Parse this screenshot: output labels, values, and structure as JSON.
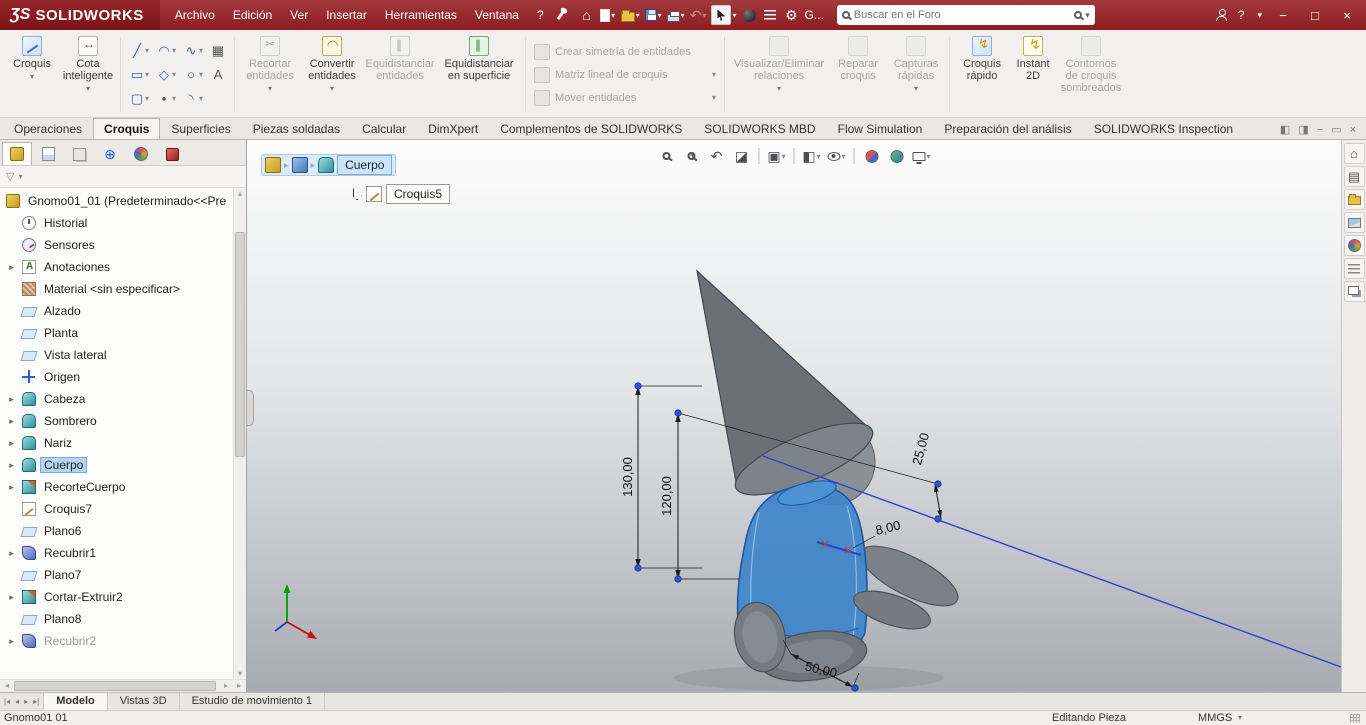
{
  "colors": {
    "titlebar": "#9b2a2e",
    "selection": "#b5d6f2",
    "body_blue": "#3e85c9"
  },
  "icons": {
    "dd": "▾",
    "exp": "▸",
    "home": "⌂",
    "gear": "⚙",
    "undo": "↶",
    "help": "?",
    "min": "−",
    "max": "□",
    "close": "×",
    "left": "◂",
    "right": "▸",
    "up": "▴",
    "down": "▾",
    "funnel": "▽",
    "section": "◪",
    "cube": "▣",
    "halfcube": "◧",
    "prev": "↶",
    "stack": "▤",
    "target": "⊕",
    "paneL": "◧",
    "paneR": "◨",
    "restore": "▭"
  },
  "tools": {
    "line": "╱",
    "arc": "◠",
    "spline": "∿",
    "pattern": "▦",
    "rect": "▭",
    "polygon": "◇",
    "circle": "○",
    "text": "A",
    "slot": "▢",
    "point": "•",
    "arc2": "◝"
  },
  "titlebar": {
    "logo_ds": "ƷS",
    "logo_text": "SOLIDWORKS",
    "menus": [
      "Archivo",
      "Edición",
      "Ver",
      "Insertar",
      "Herramientas",
      "Ventana",
      "?"
    ],
    "g_menu": "G...",
    "search_placeholder": "Buscar en el Foro"
  },
  "ribbon": {
    "r_croquis": "Croquis",
    "r_cota1": "Cota",
    "r_cota2": "inteligente",
    "r_rec1": "Recortar",
    "r_rec2": "entidades",
    "r_con1": "Convertir",
    "r_con2": "entidades",
    "r_eq1": "Equidistanciar",
    "r_eq2": "entidades",
    "r_es1": "Equidistanciar",
    "r_es2": "en superficie",
    "r_sim": "Crear simetría de entidades",
    "r_mat": "Matriz lineal de croquis",
    "r_mov": "Mover entidades",
    "r_vis1": "Visualizar/Eliminar",
    "r_vis2": "relaciones",
    "r_rep1": "Reparar",
    "r_rep2": "croquis",
    "r_cap1": "Capturas",
    "r_cap2": "rápidas",
    "r_cr1": "Croquis",
    "r_cr2": "rápido",
    "r_in1": "Instant",
    "r_in2": "2D",
    "r_co1": "Contornos",
    "r_co2": "de croquis",
    "r_co3": "sombreados"
  },
  "tabs": [
    "Operaciones",
    "Croquis",
    "Superficies",
    "Piezas soldadas",
    "Calcular",
    "DimXpert",
    "Complementos de SOLIDWORKS",
    "SOLIDWORKS MBD",
    "Flow Simulation",
    "Preparación del análisis",
    "SOLIDWORKS Inspection"
  ],
  "tree": {
    "items": [
      "Gnomo01_01 (Predeterminado<<Pre",
      "Historial",
      "Sensores",
      "Anotaciones",
      "Material <sin especificar>",
      "Alzado",
      "Planta",
      "Vista lateral",
      "Origen",
      "Cabeza",
      "Sombrero",
      "Nariz",
      "Cuerpo",
      "RecorteCuerpo",
      "Croquis7",
      "Plano6",
      "Recubrir1",
      "Plano7",
      "Cortar-Extruir2",
      "Plano8",
      "Recubrir2"
    ]
  },
  "viewport": {
    "breadcrumb_feature": "Cuerpo",
    "breadcrumb_sketch": "Croquis5",
    "dims": {
      "d130": "130,00",
      "d120": "120,00",
      "d25": "25,00",
      "d8": "8,00",
      "d50": "50,00"
    }
  },
  "bottombar": {
    "nav": [
      "|◂",
      "◂",
      "▸",
      "▸|"
    ],
    "tabs": [
      "Modelo",
      "Vistas 3D",
      "Estudio de movimiento 1"
    ]
  },
  "statusbar": {
    "doc": "Gnomo01 01",
    "mode": "Editando Pieza",
    "units": "MMGS"
  }
}
